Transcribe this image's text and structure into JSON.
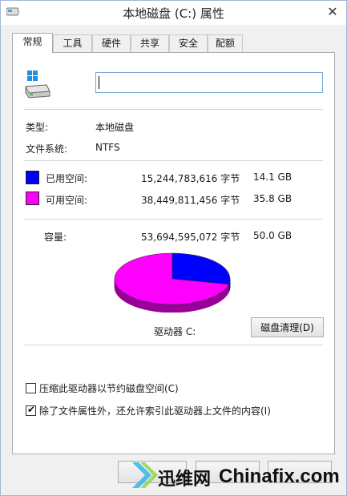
{
  "window": {
    "title": "本地磁盘 (C:) 属性",
    "close_glyph": "✕"
  },
  "tabs": [
    {
      "label": "常规",
      "active": true
    },
    {
      "label": "工具"
    },
    {
      "label": "硬件"
    },
    {
      "label": "共享"
    },
    {
      "label": "安全"
    },
    {
      "label": "配额"
    }
  ],
  "general": {
    "name_value": "",
    "type_label": "类型:",
    "type_value": "本地磁盘",
    "fs_label": "文件系统:",
    "fs_value": "NTFS",
    "used": {
      "label": "已用空间:",
      "bytes": "15,244,783,616 字节",
      "size": "14.1 GB",
      "color": "#0000ff"
    },
    "free": {
      "label": "可用空间:",
      "bytes": "38,449,811,456 字节",
      "size": "35.8 GB",
      "color": "#ff00ff"
    },
    "capacity": {
      "label": "容量:",
      "bytes": "53,694,595,072 字节",
      "size": "50.0 GB"
    },
    "drive_label": "驱动器 C:",
    "cleanup_button": "磁盘清理(D)",
    "compress_label": "压缩此驱动器以节约磁盘空间(C)",
    "compress_checked": false,
    "index_label": "除了文件属性外，还允许索引此驱动器上文件的内容(I)",
    "index_checked": true
  },
  "icons": {
    "app": "drive-icon",
    "drive": "drive-icon",
    "close": "close-icon"
  },
  "watermark": {
    "text1": "迅维网",
    "text2": "Chinafix.com"
  }
}
